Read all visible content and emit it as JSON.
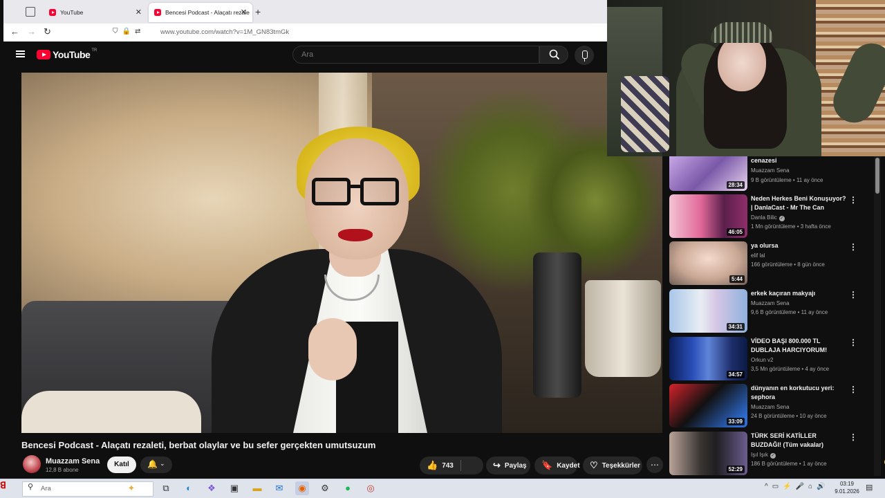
{
  "browser": {
    "tabs": [
      {
        "title": "YouTube",
        "active": false
      },
      {
        "title": "Bencesi Podcast - Alaçatı rezale",
        "active": true
      }
    ],
    "url_host": "www.youtube.com",
    "url_path": "/watch?v=1M_GN83tmGk"
  },
  "youtube": {
    "logo_text": "YouTube",
    "country_code": "TR",
    "search_placeholder": "Ara"
  },
  "video": {
    "title": "Bencesi Podcast - Alaçatı rezaleti, berbat olaylar ve bu sefer gerçekten umutsuzum",
    "channel": "Muazzam Sena",
    "subscribers": "12,8 B abone",
    "join_label": "Katıl",
    "likes": "743",
    "share_label": "Paylaş",
    "save_label": "Kaydet",
    "thanks_label": "Teşekkürler"
  },
  "recommendations": [
    {
      "title": "cenazesi",
      "channel": "Muazzam Sena",
      "verified": false,
      "meta": "9 B görüntüleme • 11 ay önce",
      "duration": "28:34",
      "thumb_text": "GOOD GIRL"
    },
    {
      "title": "Neden Herkes Beni Konuşuyor? | DanlaCast - Mr The Can",
      "channel": "Danla Bilic",
      "verified": true,
      "meta": "1 Mn görüntüleme • 3 hafta önce",
      "duration": "46:05",
      "thumb_text": "danlacast"
    },
    {
      "title": "ya olursa",
      "channel": "elif lal",
      "verified": false,
      "meta": "166 görüntüleme • 8 gün önce",
      "duration": "5:44",
      "thumb_text": ""
    },
    {
      "title": "erkek kaçıran makyajı",
      "channel": "Muazzam Sena",
      "verified": false,
      "meta": "9,6 B görüntüleme • 11 ay önce",
      "duration": "34:31",
      "thumb_text": "ERKEK KAÇIRAN"
    },
    {
      "title": "VİDEO BAŞI 800.000 TL DUBLAJA HARCIYORUM! Ruhi...",
      "channel": "Orkun v2",
      "verified": false,
      "meta": "3,5 Mn görüntüleme • 4 ay önce",
      "duration": "34:57",
      "thumb_text": ""
    },
    {
      "title": "dünyanın en korkutucu yeri: sephora",
      "channel": "Muazzam Sena",
      "verified": false,
      "meta": "24 B görüntüleme • 10 ay önce",
      "duration": "33:09",
      "thumb_text": "SEPHORA"
    },
    {
      "title": "TÜRK SERİ KATİLLER BUZDAĞI! (Tüm vakalar)",
      "channel": "Işıl Işık",
      "verified": true,
      "meta": "186 B görüntüleme • 1 ay önce",
      "duration": "52:29",
      "thumb_text": "BÜTÜN"
    }
  ],
  "taskbar": {
    "search_placeholder": "Ara",
    "time": "03:19",
    "date": "9.01.2026"
  },
  "colors": {
    "youtube_red": "#ff0033",
    "background": "#0f0f0f"
  }
}
